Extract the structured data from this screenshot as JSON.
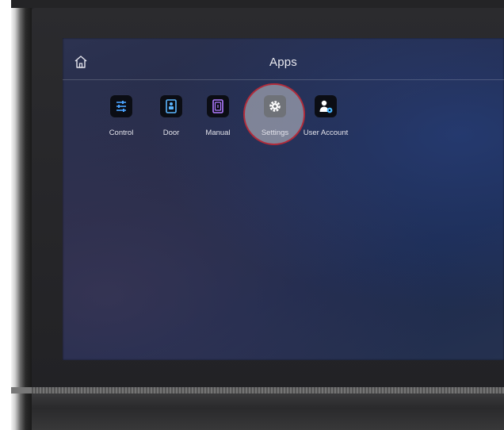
{
  "header": {
    "title": "Apps",
    "home_icon": "home-icon"
  },
  "apps": [
    {
      "label": "Control",
      "icon": "sliders-icon",
      "accent": "#4aa3ff",
      "selected": false
    },
    {
      "label": "Door",
      "icon": "door-intercom-icon",
      "accent": "#5bb6ff",
      "selected": false
    },
    {
      "label": "Manual",
      "icon": "book-icon",
      "accent": "#b07bff",
      "selected": false
    },
    {
      "label": "Settings",
      "icon": "gear-icon",
      "accent": "#ffffff",
      "selected": true
    },
    {
      "label": "User Account",
      "icon": "user-account-icon",
      "accent": "#4ab8ff",
      "selected": false
    }
  ],
  "colors": {
    "selection_ring": "#b12b3a",
    "title_text": "#e8e8ee"
  }
}
